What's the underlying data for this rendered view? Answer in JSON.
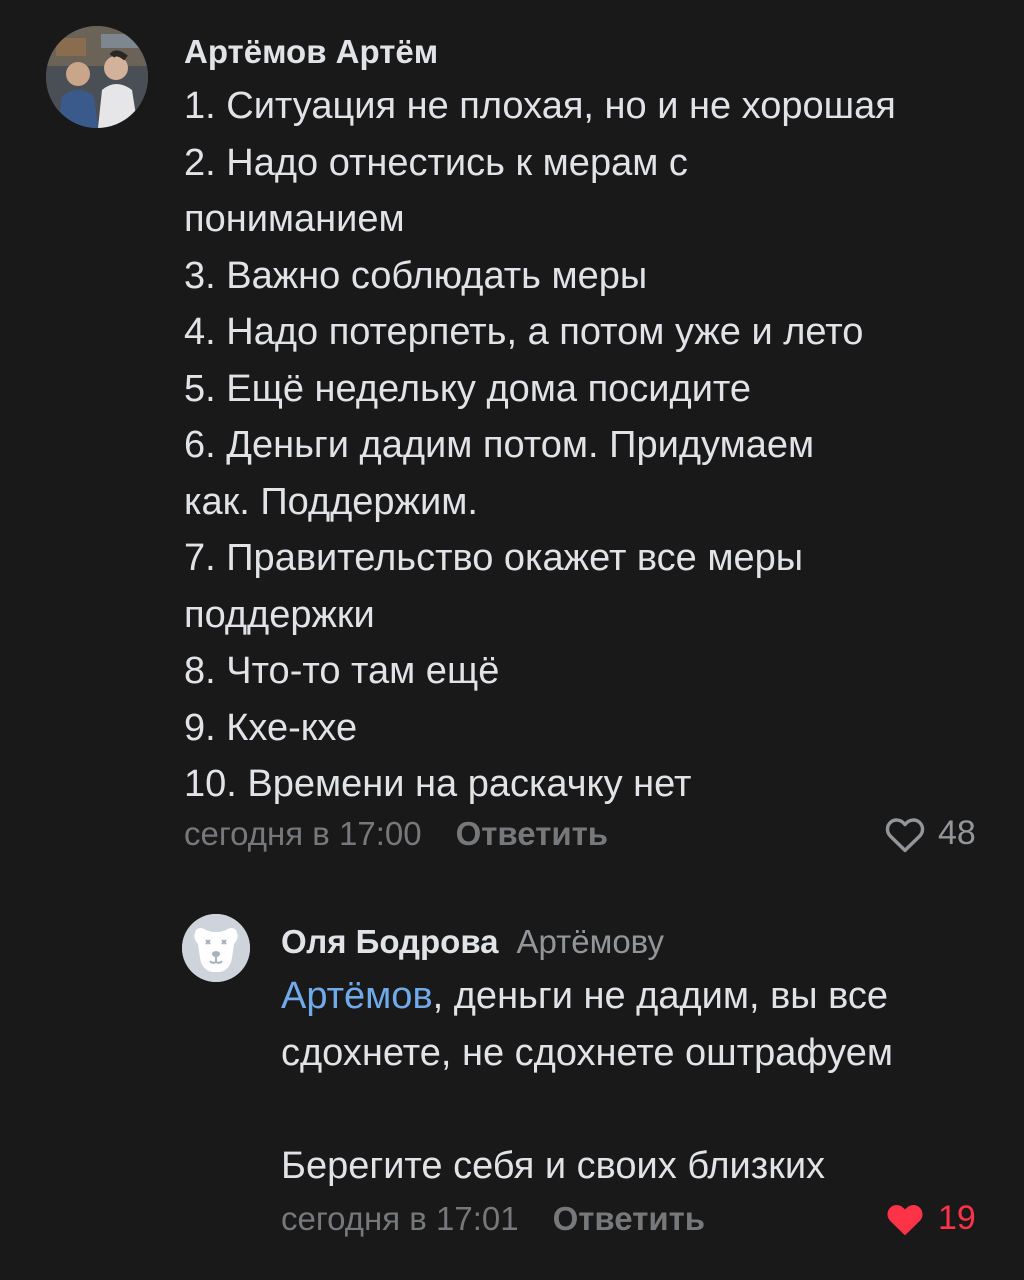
{
  "comments": [
    {
      "author": "Артёмов Артём",
      "lines": [
        "1. Ситуация не плохая, но и не хорошая",
        "2. Надо отнестись к мерам с",
        "пониманием",
        "3. Важно соблюдать меры",
        "4. Надо потерпеть, а потом уже и лето",
        "5. Ещё недельку дома посидите",
        "6. Деньги дадим потом. Придумаем",
        "как. Поддержим.",
        "7. Правительство окажет все меры",
        "поддержки",
        "8. Что-то там ещё",
        "9. Кхе-кхе",
        "10. Времени на раскачку нет"
      ],
      "time": "сегодня в 17:00",
      "reply_label": "Ответить",
      "likes": "48",
      "liked": false,
      "heart_icon": "heart-outline-icon"
    },
    {
      "author": "Оля Бодрова",
      "reply_to": "Артёмову",
      "mention": "Артёмов",
      "line1_rest": ", деньги не дадим, вы все",
      "line2": "сдохнете, не сдохнете оштрафуем",
      "line3": "Берегите себя и своих близких",
      "time": "сегодня в 17:01",
      "reply_label": "Ответить",
      "likes": "19",
      "liked": true,
      "heart_icon": "heart-filled-icon"
    }
  ],
  "colors": {
    "background": "#19191a",
    "text": "#e1e3e6",
    "secondary": "#76787a",
    "mention": "#71aaeb",
    "like_active": "#ff3347"
  }
}
